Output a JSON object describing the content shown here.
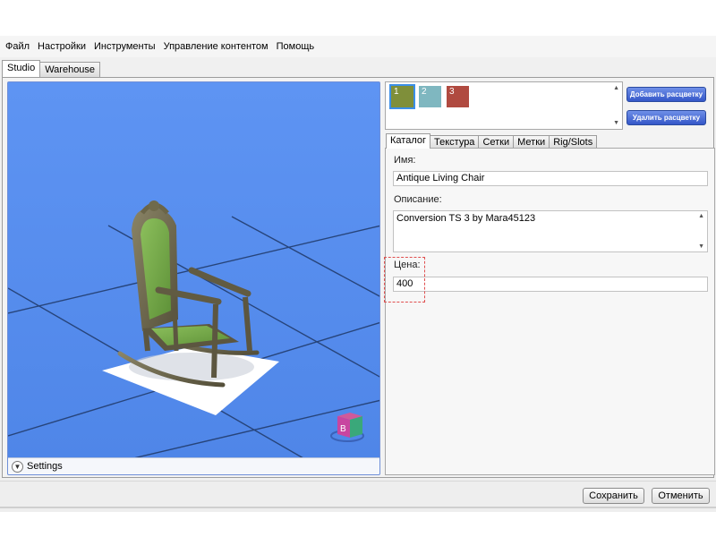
{
  "menu": [
    "Файл",
    "Настройки",
    "Инструменты",
    "Управление контентом",
    "Помощь"
  ],
  "top_tabs": [
    {
      "label": "Studio",
      "active": true
    },
    {
      "label": "Warehouse",
      "active": false
    }
  ],
  "viewport": {
    "settings_label": "Settings",
    "bg_color": "#5a8ff0",
    "object": "rocking-chair"
  },
  "swatches": [
    {
      "label": "1",
      "color": "#7f8f3a",
      "selected": true
    },
    {
      "label": "2",
      "color": "#7fb7c0",
      "selected": false
    },
    {
      "label": "3",
      "color": "#b04a40",
      "selected": false
    }
  ],
  "actions": {
    "add_swatch": "Добавить расцветку",
    "remove_swatch": "Удалить расцветку"
  },
  "props_tabs": [
    {
      "label": "Каталог",
      "active": true
    },
    {
      "label": "Текстура",
      "active": false
    },
    {
      "label": "Сетки",
      "active": false
    },
    {
      "label": "Метки",
      "active": false
    },
    {
      "label": "Rig/Slots",
      "active": false
    }
  ],
  "catalog": {
    "name_label": "Имя:",
    "name_value": "Antique Living Chair",
    "desc_label": "Описание:",
    "desc_value": "Conversion TS 3 by Mara45123",
    "price_label": "Цена:",
    "price_value": "400"
  },
  "footer": {
    "save": "Сохранить",
    "cancel": "Отменить"
  },
  "colors": {
    "accent_blue": "#3457c8",
    "highlight": "#e05050"
  }
}
